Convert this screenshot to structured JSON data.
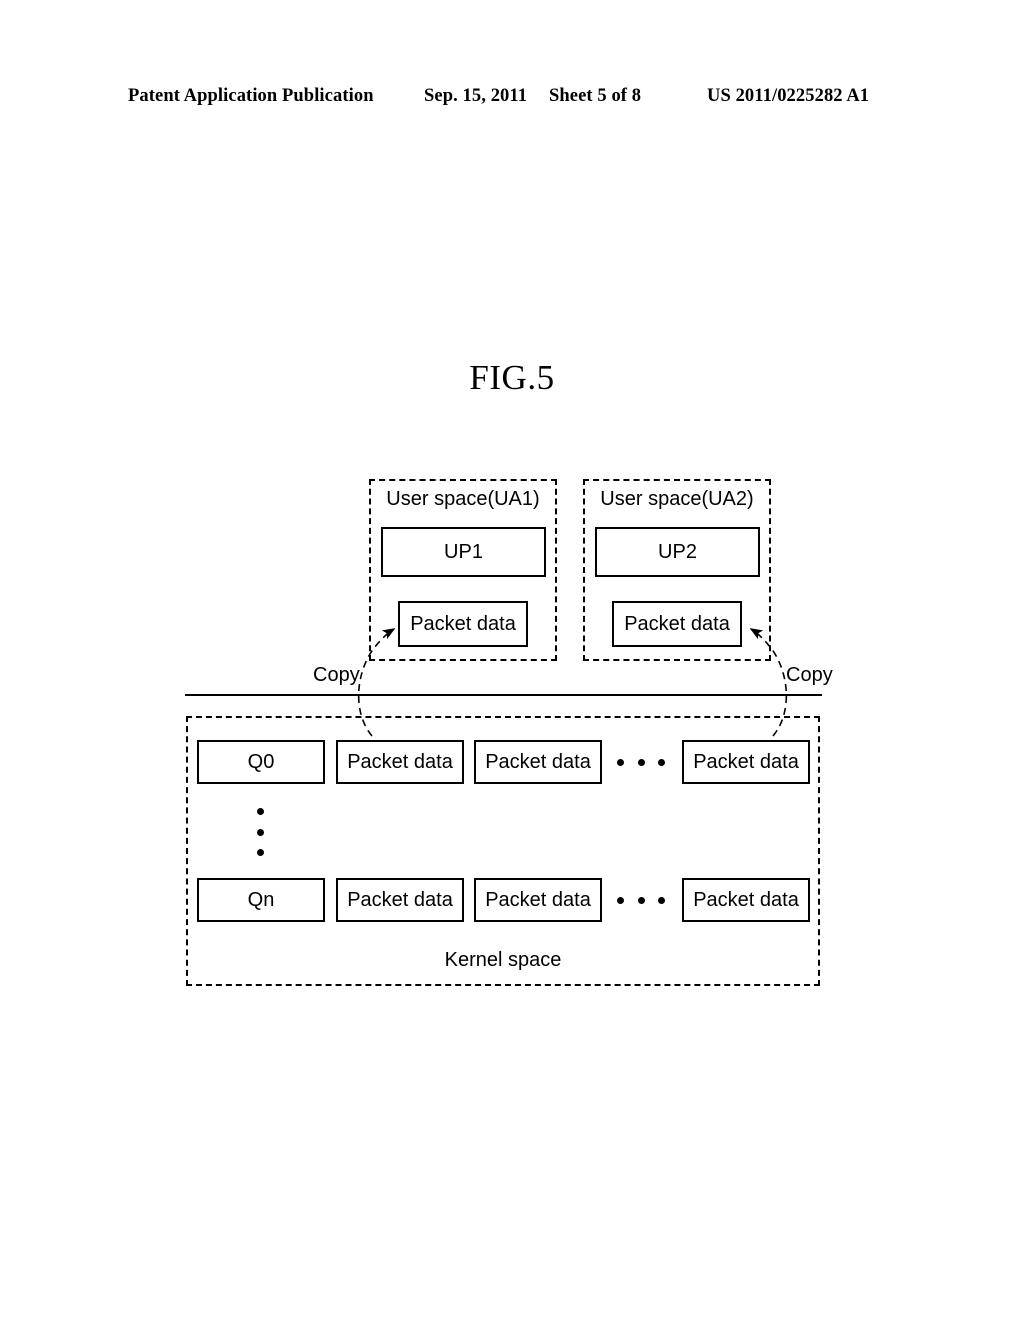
{
  "header": {
    "publication": "Patent Application Publication",
    "date": "Sep. 15, 2011",
    "sheet": "Sheet 5 of 8",
    "document_number": "US 2011/0225282 A1"
  },
  "figure": {
    "title": "FIG.5",
    "user_spaces": [
      {
        "title": "User space(UA1)",
        "process_box": "UP1",
        "packet_box": "Packet data"
      },
      {
        "title": "User space(UA2)",
        "process_box": "UP2",
        "packet_box": "Packet data"
      }
    ],
    "copy_labels": {
      "left": "Copy",
      "right": "Copy"
    },
    "kernel_space": {
      "title": "Kernel space",
      "queues": [
        {
          "name": "Q0",
          "packets": [
            "Packet data",
            "Packet data",
            "Packet data"
          ]
        },
        {
          "name": "Qn",
          "packets": [
            "Packet data",
            "Packet data",
            "Packet data"
          ]
        }
      ]
    },
    "colors": {
      "stroke": "#000000",
      "background": "#ffffff"
    }
  }
}
